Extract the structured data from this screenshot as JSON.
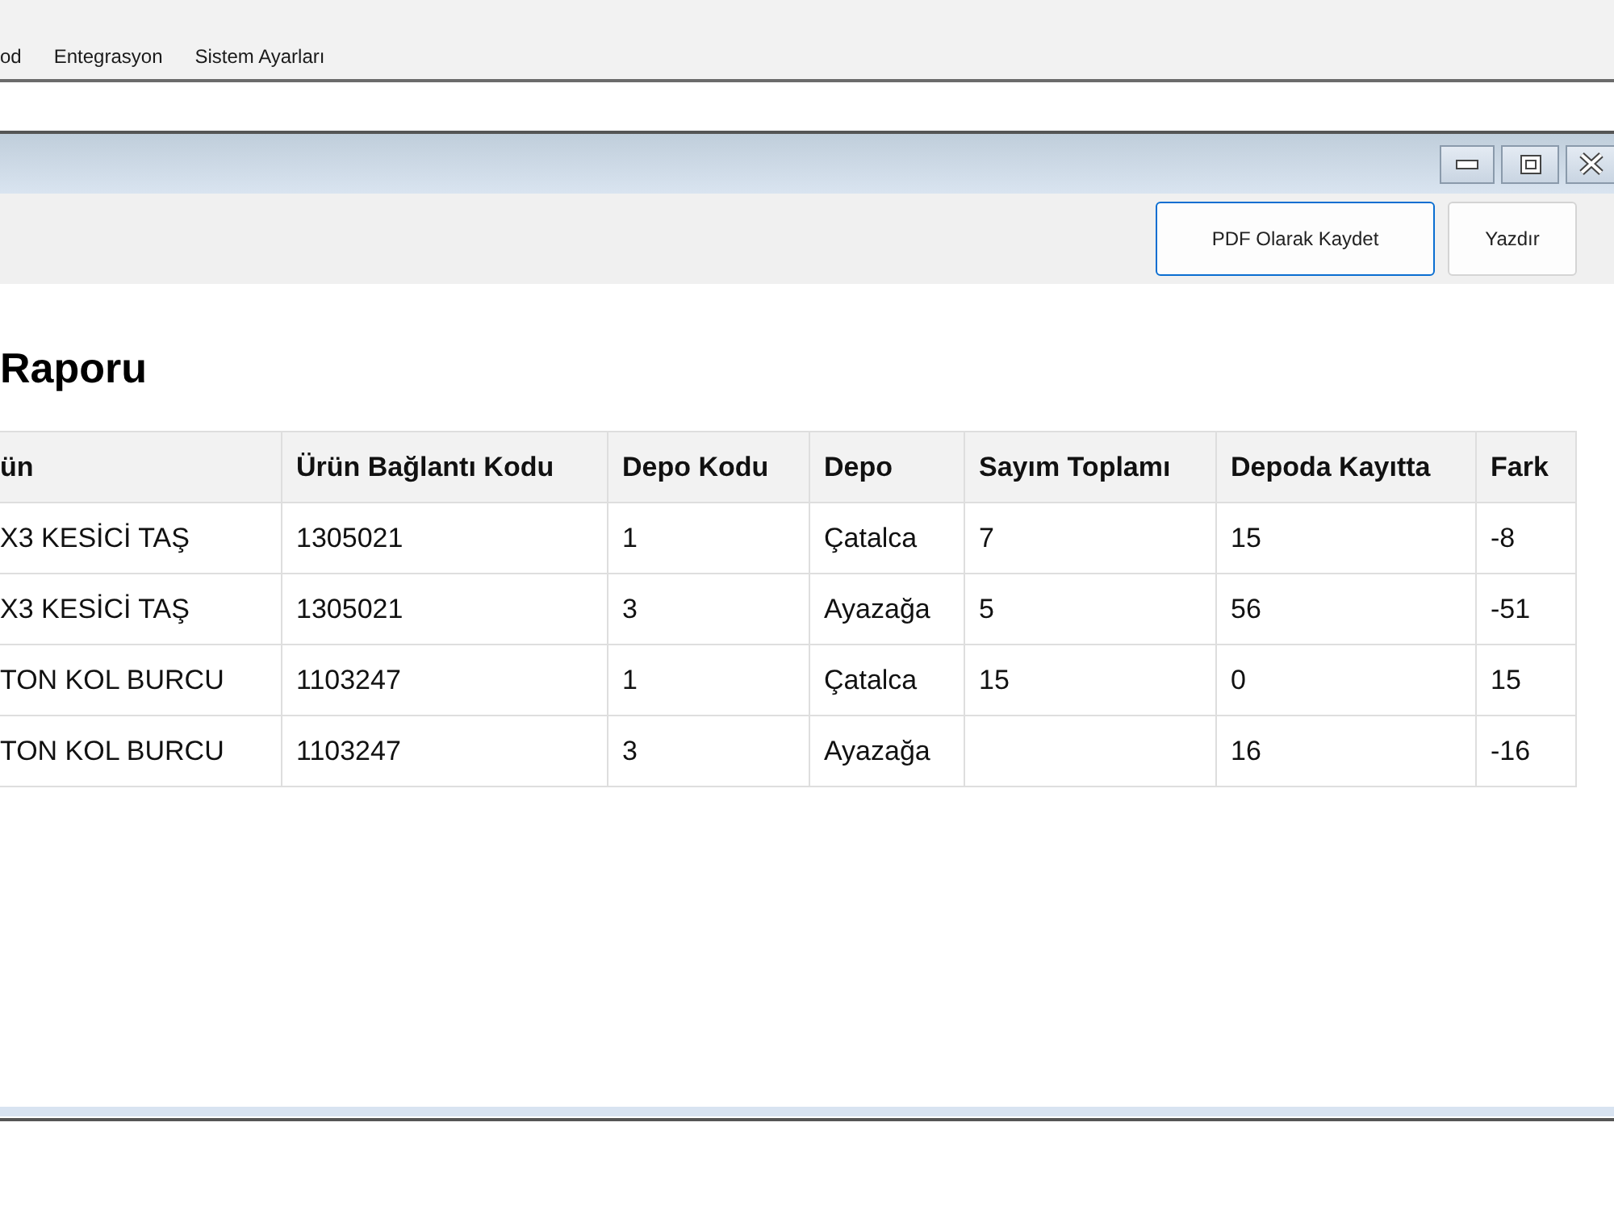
{
  "menu": [
    "od",
    "Entegrasyon",
    "Sistem Ayarları"
  ],
  "toolbar": {
    "buttons": [
      {
        "label": "PDF Olarak Kaydet",
        "selected": true
      },
      {
        "label": "Yazdır",
        "selected": false
      }
    ]
  },
  "report": {
    "title": "Raporu",
    "table": {
      "columns": [
        "ün",
        "Ürün Bağlantı Kodu",
        "Depo Kodu",
        "Depo",
        "Sayım Toplamı",
        "Depoda Kayıtta",
        "Fark"
      ],
      "rows": [
        [
          "X3 KESİCİ TAŞ",
          "1305021",
          "1",
          "Çatalca",
          "7",
          "15",
          "-8"
        ],
        [
          "X3 KESİCİ TAŞ",
          "1305021",
          "3",
          "Ayazağa",
          "5",
          "56",
          "-51"
        ],
        [
          "TON KOL BURCU",
          "1103247",
          "1",
          "Çatalca",
          "15",
          "0",
          "15"
        ],
        [
          "TON KOL BURCU",
          "1103247",
          "3",
          "Ayazağa",
          "",
          "16",
          "-16"
        ]
      ]
    }
  }
}
